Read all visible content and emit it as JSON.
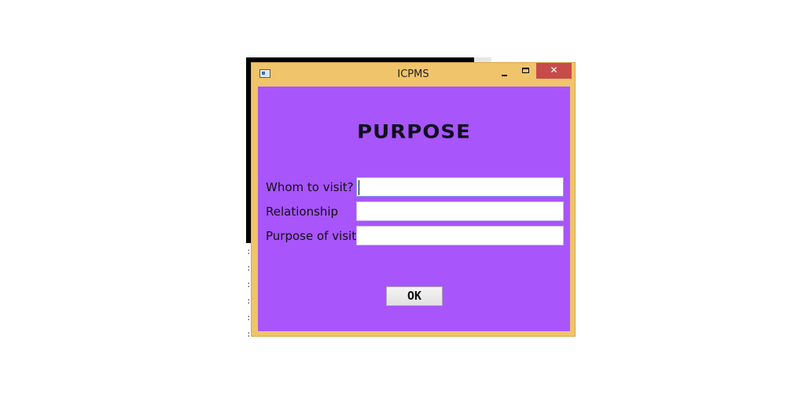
{
  "background_window": {
    "line_glyphs": [
      ":",
      ":",
      ":",
      ":",
      ":",
      ":"
    ]
  },
  "window": {
    "title": "ICPMS",
    "controls": {
      "minimize": "minimize",
      "maximize": "maximize",
      "close": "✕"
    }
  },
  "form": {
    "heading": "PURPOSE",
    "fields": [
      {
        "label": "Whom to visit?",
        "value": "",
        "focused": true
      },
      {
        "label": "Relationship",
        "value": ""
      },
      {
        "label": "Purpose of visit",
        "value": ""
      }
    ],
    "ok_label": "OK"
  },
  "colors": {
    "window_frame": "#f0c46a",
    "client_background": "#a855fc",
    "close_button": "#c74b4b"
  }
}
